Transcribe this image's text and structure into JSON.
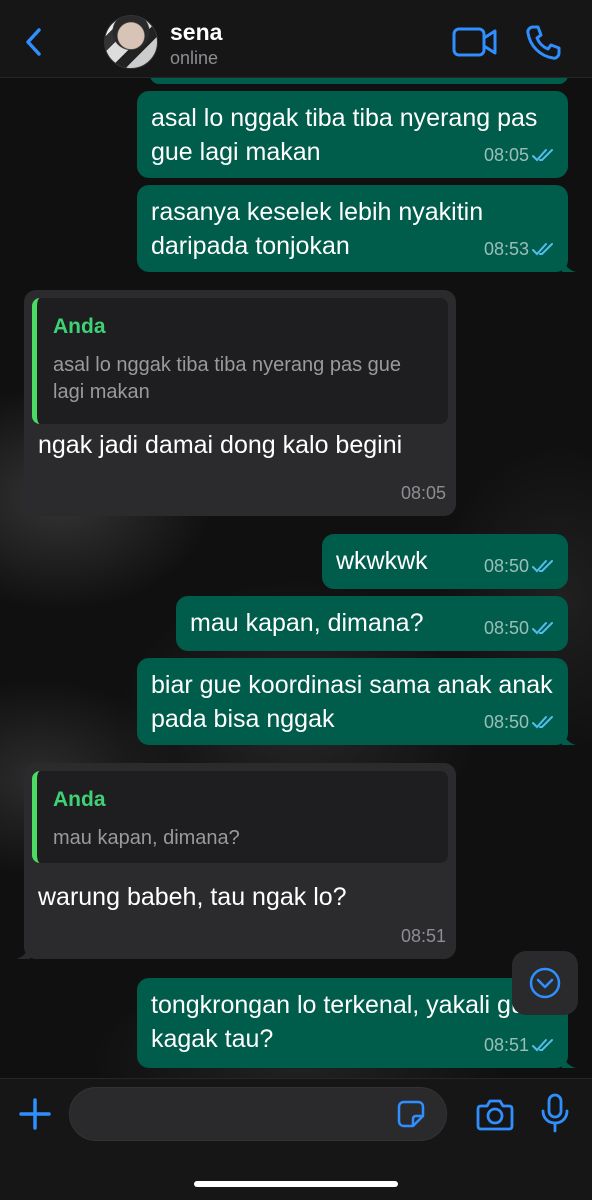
{
  "header": {
    "back_icon": "chevron-left-icon",
    "contact_name": "sena",
    "status": "online",
    "video_icon": "video-camera-icon",
    "call_icon": "phone-icon"
  },
  "colors": {
    "accent": "#2f8fff",
    "outgoing_bubble": "#005c4b",
    "incoming_bubble": "#2b2b2d",
    "quote_author": "#3fd175",
    "read_ticks": "#53bdeb"
  },
  "messages": [
    {
      "direction": "out",
      "text": "asal lo nggak tiba tiba nyerang pas gue lagi makan",
      "time": "08:05",
      "read": true
    },
    {
      "direction": "out",
      "text": "rasanya keselek lebih nyakitin daripada tonjokan",
      "time": "08:53",
      "read": true
    },
    {
      "direction": "in",
      "quote_author": "Anda",
      "quote_text": "asal lo nggak tiba tiba nyerang pas gue lagi makan",
      "text": "ngak jadi damai dong kalo begini",
      "time": "08:05"
    },
    {
      "direction": "out",
      "text": "wkwkwk",
      "time": "08:50",
      "read": true
    },
    {
      "direction": "out",
      "text": "mau kapan, dimana?",
      "time": "08:50",
      "read": true
    },
    {
      "direction": "out",
      "text": "biar gue koordinasi sama anak anak pada bisa nggak",
      "time": "08:50",
      "read": true
    },
    {
      "direction": "in",
      "quote_author": "Anda",
      "quote_text": "mau kapan, dimana?",
      "text": "warung babeh, tau ngak lo?",
      "time": "08:51"
    },
    {
      "direction": "out",
      "text": "tongkrongan lo terkenal, yakali gue kagak tau?",
      "time": "08:51",
      "read": true
    }
  ],
  "composer": {
    "input_value": "",
    "plus_icon": "plus-icon",
    "sticker_icon": "sticker-icon",
    "camera_icon": "camera-icon",
    "mic_icon": "microphone-icon"
  },
  "scroll_down_icon": "chevron-down-circle-icon"
}
